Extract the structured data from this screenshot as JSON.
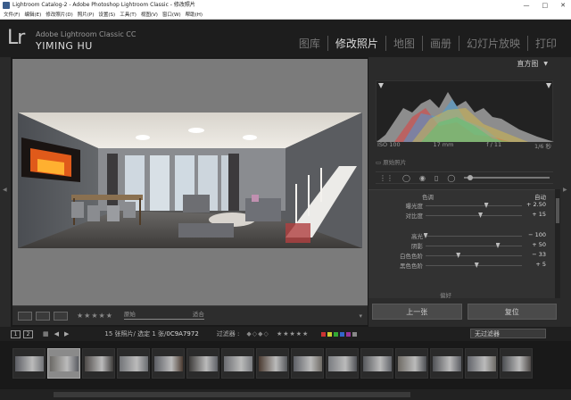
{
  "window": {
    "title": "Lightroom Catalog-2 - Adobe Photoshop Lightroom Classic - 修改照片",
    "controls": [
      "—",
      "□",
      "✕"
    ]
  },
  "menu": [
    "文件(F)",
    "编辑(E)",
    "修改照片(D)",
    "照片(P)",
    "设置(S)",
    "工具(T)",
    "视图(V)",
    "窗口(W)",
    "帮助(H)"
  ],
  "identity": {
    "logo": "Lr",
    "brand": "Adobe Lightroom Classic CC",
    "user": "YIMING HU"
  },
  "modules": [
    {
      "label": "图库",
      "active": false
    },
    {
      "label": "修改照片",
      "active": true
    },
    {
      "label": "地图",
      "active": false
    },
    {
      "label": "画册",
      "active": false
    },
    {
      "label": "幻灯片放映",
      "active": false
    },
    {
      "label": "打印",
      "active": false
    }
  ],
  "toolbar": {
    "stars": "★★★★★",
    "slider_left": "原始",
    "slider_right": "适合"
  },
  "histogram": {
    "title": "直方图",
    "iso": "ISO 100",
    "focal": "17 mm",
    "aperture": "f / 11",
    "shutter": "1/6 秒",
    "original": "原始照片"
  },
  "basic": {
    "tone_label": "色调",
    "auto_label": "自动",
    "presence_label": "偏好",
    "rows": [
      {
        "label": "曝光度",
        "value": "+ 2.50",
        "pos": 0.63
      },
      {
        "label": "对比度",
        "value": "+ 15",
        "pos": 0.57
      },
      {
        "label": "高光",
        "value": "− 100",
        "pos": 0.0
      },
      {
        "label": "阴影",
        "value": "+ 50",
        "pos": 0.75
      },
      {
        "label": "白色色阶",
        "value": "− 33",
        "pos": 0.34
      },
      {
        "label": "黑色色阶",
        "value": "+ 5",
        "pos": 0.53
      }
    ]
  },
  "buttons": {
    "previous": "上一张",
    "reset": "复位"
  },
  "filmstrip": {
    "screen1": "1",
    "screen2": "2",
    "count": "15 张照片/ 选定 1 张/",
    "filename": "0C9A7972",
    "filter_label": "过滤器 :",
    "shapes": "◆◇◆◇",
    "stars": "★★★★★",
    "flag_colors": [
      "#c33",
      "#cc3",
      "#3a3",
      "#36c",
      "#939",
      "#888"
    ],
    "filter_value": "无过滤器",
    "thumb_count": 15,
    "selected_index": 1
  }
}
